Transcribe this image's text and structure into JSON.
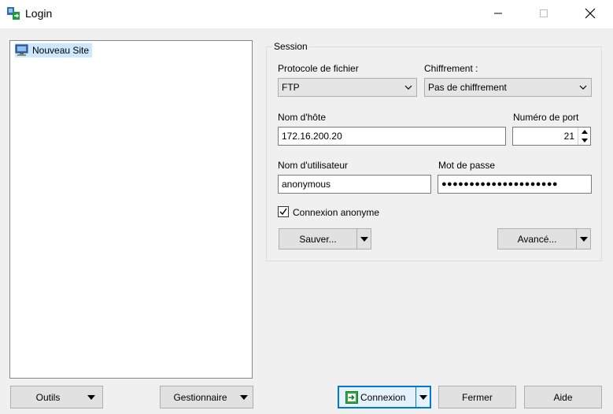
{
  "window": {
    "title": "Login"
  },
  "sites": {
    "items": [
      {
        "label": "Nouveau Site"
      }
    ]
  },
  "session": {
    "group_label": "Session",
    "protocol": {
      "label": "Protocole de fichier",
      "value": "FTP"
    },
    "encryption": {
      "label": "Chiffrement :",
      "value": "Pas de chiffrement"
    },
    "host": {
      "label": "Nom d'hôte",
      "value": "172.16.200.20"
    },
    "port": {
      "label": "Numéro de port",
      "value": "21"
    },
    "user": {
      "label": "Nom d'utilisateur",
      "value": "anonymous"
    },
    "password": {
      "label": "Mot de passe",
      "value": "●●●●●●●●●●●●●●●●●●●●●"
    },
    "anonymous": {
      "label": "Connexion anonyme",
      "checked": true
    },
    "save_label": "Sauver...",
    "advanced_label": "Avancé..."
  },
  "footer": {
    "tools_label": "Outils",
    "manager_label": "Gestionnaire",
    "connect_label": "Connexion",
    "close_label": "Fermer",
    "help_label": "Aide"
  }
}
